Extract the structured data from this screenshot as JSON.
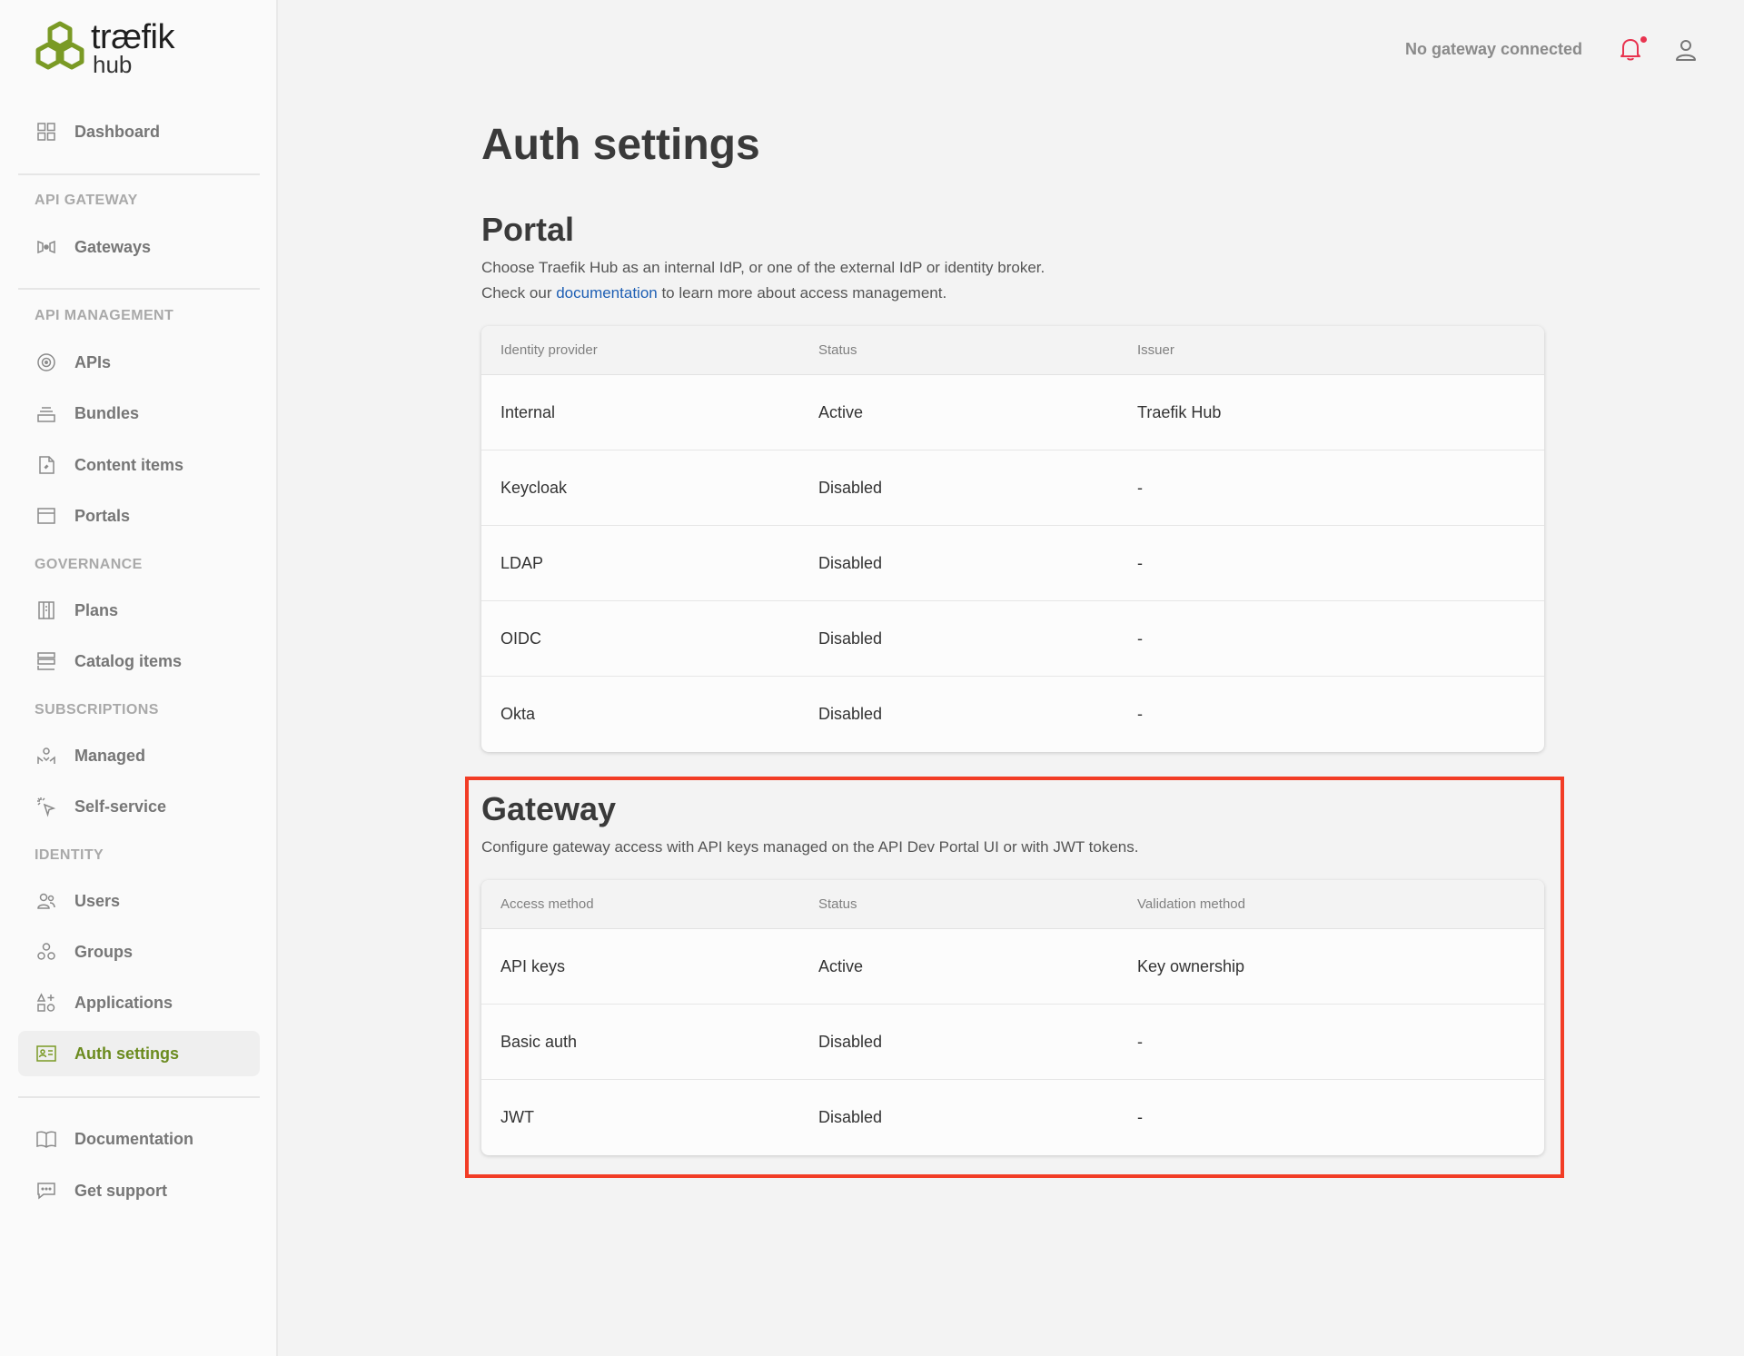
{
  "logo": {
    "brand": "træfik",
    "sub": "hub"
  },
  "header": {
    "gateway_status": "No gateway connected",
    "bell_icon": "bell-icon",
    "user_icon": "user-icon",
    "colors": {
      "notification_dot": "#e8334f"
    }
  },
  "sidebar": {
    "accent_color": "#6b8b1f",
    "dashboard": "Dashboard",
    "sections": {
      "api_gateway": "API GATEWAY",
      "api_management": "API MANAGEMENT",
      "governance": "GOVERNANCE",
      "subscriptions": "SUBSCRIPTIONS",
      "identity": "IDENTITY"
    },
    "items": {
      "gateways": "Gateways",
      "apis": "APIs",
      "bundles": "Bundles",
      "content_items": "Content items",
      "portals": "Portals",
      "plans": "Plans",
      "catalog_items": "Catalog items",
      "managed": "Managed",
      "self_service": "Self-service",
      "users": "Users",
      "groups": "Groups",
      "applications": "Applications",
      "auth_settings": "Auth settings"
    },
    "footer": {
      "documentation": "Documentation",
      "get_support": "Get support"
    }
  },
  "main": {
    "title": "Auth settings",
    "portal": {
      "title": "Portal",
      "desc_line1": "Choose Traefik Hub as an internal IdP, or one of the external IdP or identity broker.",
      "desc_prefix": "Check our ",
      "desc_link": "documentation",
      "desc_suffix": " to learn more about access management.",
      "columns": [
        "Identity provider",
        "Status",
        "Issuer"
      ],
      "rows": [
        [
          "Internal",
          "Active",
          "Traefik Hub"
        ],
        [
          "Keycloak",
          "Disabled",
          "-"
        ],
        [
          "LDAP",
          "Disabled",
          "-"
        ],
        [
          "OIDC",
          "Disabled",
          "-"
        ],
        [
          "Okta",
          "Disabled",
          "-"
        ]
      ]
    },
    "gateway": {
      "title": "Gateway",
      "desc": "Configure gateway access with API keys managed on the API Dev Portal UI or with JWT tokens.",
      "columns": [
        "Access method",
        "Status",
        "Validation method"
      ],
      "rows": [
        [
          "API keys",
          "Active",
          "Key ownership"
        ],
        [
          "Basic auth",
          "Disabled",
          "-"
        ],
        [
          "JWT",
          "Disabled",
          "-"
        ]
      ]
    },
    "highlight_color": "#f23c25"
  }
}
